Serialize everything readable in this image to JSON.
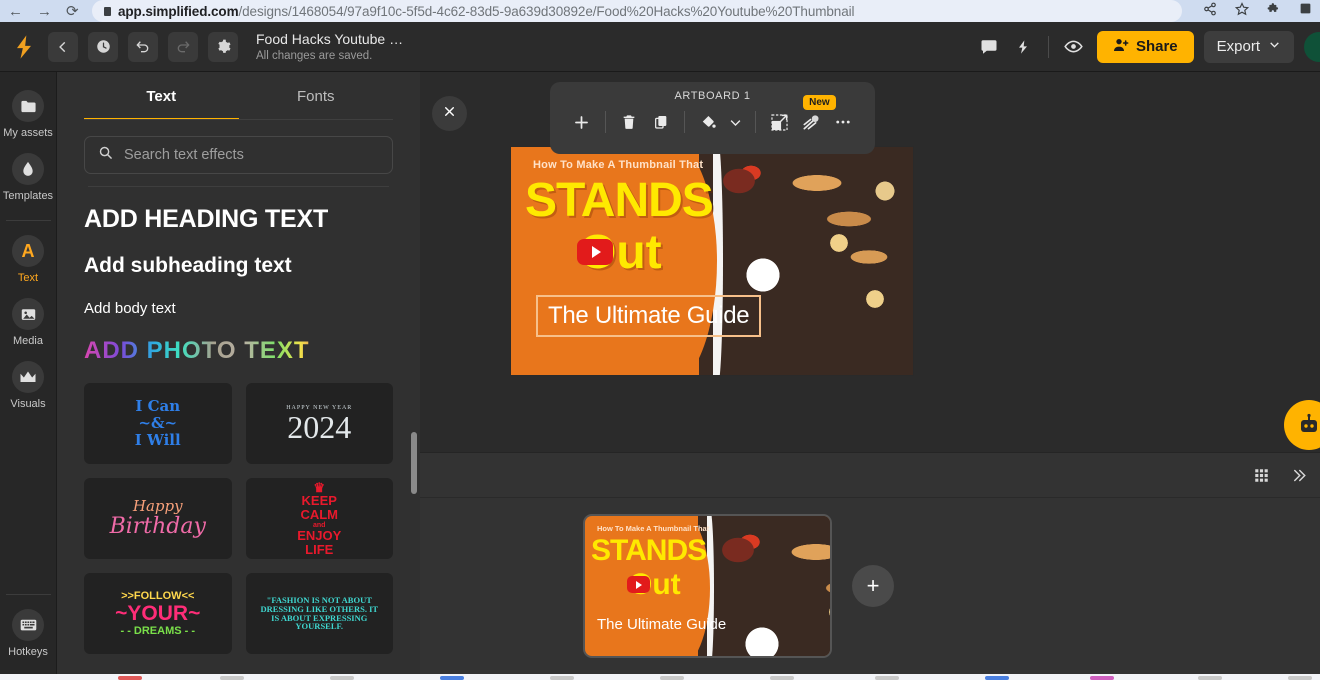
{
  "browser": {
    "back_icon": "back-arrow-icon",
    "forward_icon": "forward-arrow-icon",
    "reload_icon": "reload-icon",
    "url_domain": "app.simplified.com",
    "url_path": "/designs/1468054/97a9f10c-5f5d-4c62-83d5-9a639d30892e/Food%20Hacks%20Youtube%20Thumbnail",
    "actions": [
      "share-icon",
      "bookmark-star-icon",
      "extensions-puzzle-icon",
      "profile-square-icon"
    ]
  },
  "topbar": {
    "logo": "simplified-logo",
    "buttons": [
      {
        "name": "back-button",
        "icon": "chevron-left-icon"
      },
      {
        "name": "history-button",
        "icon": "clock-icon"
      },
      {
        "name": "undo-button",
        "icon": "undo-icon"
      },
      {
        "name": "redo-button",
        "icon": "redo-icon"
      },
      {
        "name": "settings-button",
        "icon": "gear-icon"
      }
    ],
    "doc_title": "Food Hacks Youtube …",
    "doc_status": "All changes are saved.",
    "comment_icon": "comment-bubble-icon",
    "quick_icon": "lightning-bolt-icon",
    "preview_icon": "eye-icon",
    "share_label": "Share",
    "share_icon": "person-add-icon",
    "export_label": "Export",
    "export_chevron": "chevron-down-icon",
    "avatar_initial": "",
    "share_color": "#ffb300"
  },
  "rail": {
    "items": [
      {
        "label": "My assets",
        "icon": "folder-icon",
        "active": false
      },
      {
        "label": "Templates",
        "icon": "droplet-icon",
        "active": false
      },
      {
        "label": "Text",
        "icon": "letter-a-icon",
        "active": true
      },
      {
        "label": "Media",
        "icon": "image-icon",
        "active": false
      },
      {
        "label": "Visuals",
        "icon": "crown-icon",
        "active": false
      },
      {
        "label": "Hotkeys",
        "icon": "keyboard-icon",
        "active": false
      }
    ],
    "active_color": "#ffa81f"
  },
  "panel": {
    "tabs": [
      {
        "label": "Text",
        "active": true
      },
      {
        "label": "Fonts",
        "active": false
      }
    ],
    "search_placeholder": "Search text effects",
    "search_icon": "search-icon",
    "presets": {
      "heading": "ADD HEADING TEXT",
      "subheading": "Add subheading text",
      "body": "Add body text",
      "photo_text": "ADD PHOTO TEXT"
    },
    "effects": [
      {
        "name": "i-can-i-will",
        "lines": [
          "I Can",
          "~&~",
          "I Will"
        ]
      },
      {
        "name": "happy-new-year-2024",
        "top": "HAPPY NEW YEAR",
        "number": "2024"
      },
      {
        "name": "happy-birthday",
        "line1": "Happy",
        "line2": "Birthday"
      },
      {
        "name": "keep-calm-enjoy-life",
        "crown": "♛",
        "l1": "KEEP",
        "l2": "CALM",
        "and": "and",
        "l3": "ENJOY",
        "l4": "LIFE"
      },
      {
        "name": "follow-your-dreams",
        "l1": ">>FOLLOW<<",
        "l2": "~YOUR~",
        "l3": "- - DREAMS - -"
      },
      {
        "name": "fashion-quote",
        "text": "\"FASHION IS NOT ABOUT DRESSING LIKE OTHERS. IT IS ABOUT EXPRESSING YOURSELF."
      }
    ],
    "collapse_icon": "close-icon"
  },
  "artboard_toolbar": {
    "title": "ARTBOARD 1",
    "icons": [
      {
        "name": "add-artboard-button",
        "glyph": "plus-icon"
      },
      {
        "name": "delete-artboard-button",
        "glyph": "trash-icon"
      },
      {
        "name": "duplicate-artboard-button",
        "glyph": "copy-icon"
      },
      {
        "name": "fill-color-button",
        "glyph": "paint-bucket-icon"
      },
      {
        "name": "fill-dropdown-button",
        "glyph": "chevron-down-icon"
      },
      {
        "name": "resize-artboard-button",
        "glyph": "resize-icon"
      },
      {
        "name": "magic-effects-button",
        "glyph": "magic-wand-icon"
      },
      {
        "name": "more-options-button",
        "glyph": "ellipsis-icon"
      }
    ],
    "new_badge": "New"
  },
  "artboard": {
    "kicker": "How To Make A Thumbnail That",
    "headline_line1": "STANDS",
    "headline_line2": "Out",
    "subtitle": "The Ultimate Guide",
    "bg_color": "#e8761c",
    "headline_color": "#ffe900",
    "play_badge": "youtube-play-icon"
  },
  "ai_fab": {
    "name": "ai-assistant-button",
    "icon": "robot-icon"
  },
  "pages": {
    "grid_icon": "grid-view-icon",
    "close_icon": "close-panel-icon",
    "add_page_label": "+",
    "thumb": {
      "kicker": "How To Make A Thumbnail That",
      "headline_line1": "STANDS",
      "headline_line2": "Out",
      "subtitle": "The Ultimate Guide"
    }
  }
}
